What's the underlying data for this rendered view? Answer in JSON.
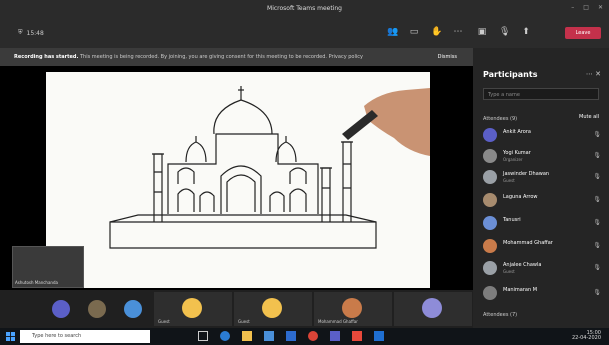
{
  "window": {
    "title": "Microsoft Teams meeting",
    "controls": [
      "–",
      "□",
      "✕"
    ]
  },
  "meeting": {
    "timer": "15:48",
    "leave_label": "Leave",
    "banner": {
      "title": "Recording has started.",
      "text": "This meeting is being recorded. By joining, you are giving consent for this meeting to be recorded. Privacy policy",
      "dismiss": "Dismiss"
    }
  },
  "self_video": {
    "name": "Ashutosh Manchanda"
  },
  "strip_tiles": [
    {
      "name": "",
      "color": "#5b5fc7"
    },
    {
      "name": "",
      "color": "#7a6a4f"
    },
    {
      "name": "",
      "color": "#4a90d9"
    },
    {
      "name": "Guest",
      "color": "#f2c14e"
    },
    {
      "name": "Guest",
      "color": "#f2c14e"
    },
    {
      "name": "Mohammad Ghaffar",
      "color": "#c97b4a"
    },
    {
      "name": "",
      "color": "#8e8cd8"
    }
  ],
  "participants": {
    "title": "Participants",
    "search_placeholder": "Type a name",
    "section_label": "Attendees (9)",
    "mute_all": "Mute all",
    "people": [
      {
        "name": "Ankit Arora",
        "role": "",
        "color": "#5b5fc7"
      },
      {
        "name": "Yogi Kumar",
        "role": "Organizer",
        "color": "#8a8a8a"
      },
      {
        "name": "Jaswinder Dhawan",
        "role": "Guest",
        "color": "#9aa0a6"
      },
      {
        "name": "Laguna Arrow",
        "role": "",
        "color": "#a78b6e"
      },
      {
        "name": "Tanusri",
        "role": "",
        "color": "#6b8fd6"
      },
      {
        "name": "Mohammad Ghaffar",
        "role": "",
        "color": "#c97b4a"
      },
      {
        "name": "Anjalee Chawla",
        "role": "Guest",
        "color": "#9aa0a6"
      },
      {
        "name": "Manimaran M",
        "role": "",
        "color": "#7d7d7d"
      }
    ],
    "footer_section": "Attendees (7)"
  },
  "taskbar": {
    "search_placeholder": "Type here to search",
    "time": "15:00",
    "date": "22-04-2020"
  }
}
